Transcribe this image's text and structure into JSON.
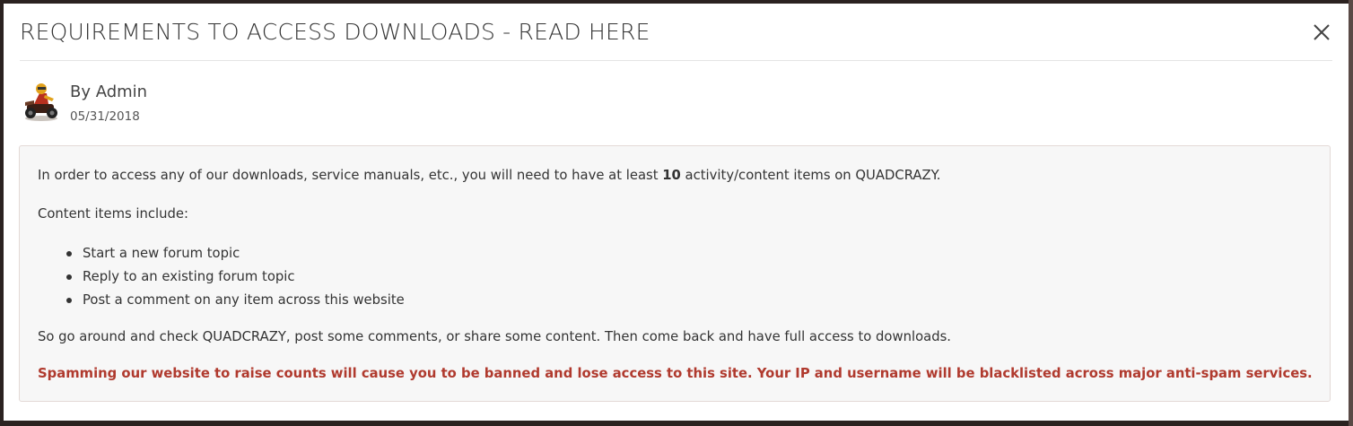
{
  "modal": {
    "title": "REQUIREMENTS TO ACCESS DOWNLOADS - READ HERE",
    "close_icon": "close-icon"
  },
  "author": {
    "by_label": "By Admin",
    "date": "05/31/2018",
    "avatar_icon": "atv-rider-avatar"
  },
  "content": {
    "intro_before": "In order to access any of our downloads, service manuals, etc., you will need to have at least ",
    "intro_count": "10",
    "intro_after": " activity/content items on QUADCRAZY.",
    "items_heading": "Content items include:",
    "items": [
      "Start a new forum topic",
      "Reply to an existing forum topic",
      "Post a comment on any item across this website"
    ],
    "closing": "So go around and check QUADCRAZY, post some comments, or share some content. Then come back and have full access to downloads.",
    "warning": "Spamming our website to raise counts will cause you to be banned and lose access to this site. Your IP and username will be blacklisted across major anti-spam services."
  },
  "colors": {
    "warning": "#b03a2e",
    "content_bg": "#f7f7f7",
    "title_text": "#333333"
  }
}
